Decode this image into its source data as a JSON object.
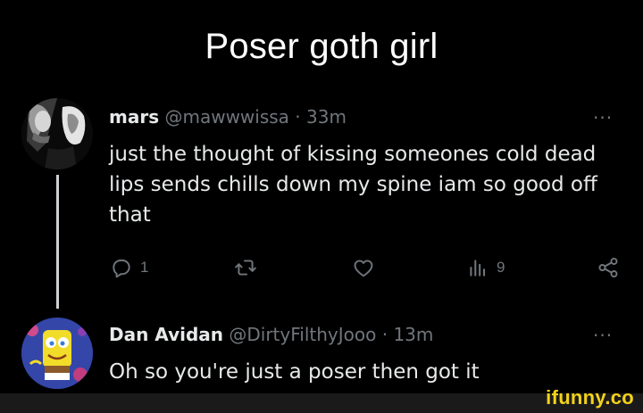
{
  "meme": {
    "title": "Poser goth girl",
    "watermark": "ifunny.co"
  },
  "tweets": [
    {
      "display_name": "mars",
      "handle": "@mawwwissa",
      "separator": "·",
      "time": "33m",
      "text": "just the thought of kissing someones cold dead lips sends chills down my spine iam so good off that",
      "more": "···",
      "actions": {
        "reply_count": "1",
        "retweet_count": "",
        "like_count": "",
        "view_count": "9"
      }
    },
    {
      "display_name": "Dan Avidan",
      "handle": "@DirtyFilthyJooo",
      "separator": "·",
      "time": "13m",
      "text": "Oh so you're just a poser then got it",
      "more": "···"
    }
  ],
  "icons": {
    "reply": "reply-icon",
    "retweet": "retweet-icon",
    "like": "heart-icon",
    "views": "views-icon",
    "share": "share-icon",
    "more": "more-icon"
  },
  "colors": {
    "background": "#000000",
    "text": "#e7e9ea",
    "secondary": "#71767b",
    "watermark": "#f3d21a"
  }
}
